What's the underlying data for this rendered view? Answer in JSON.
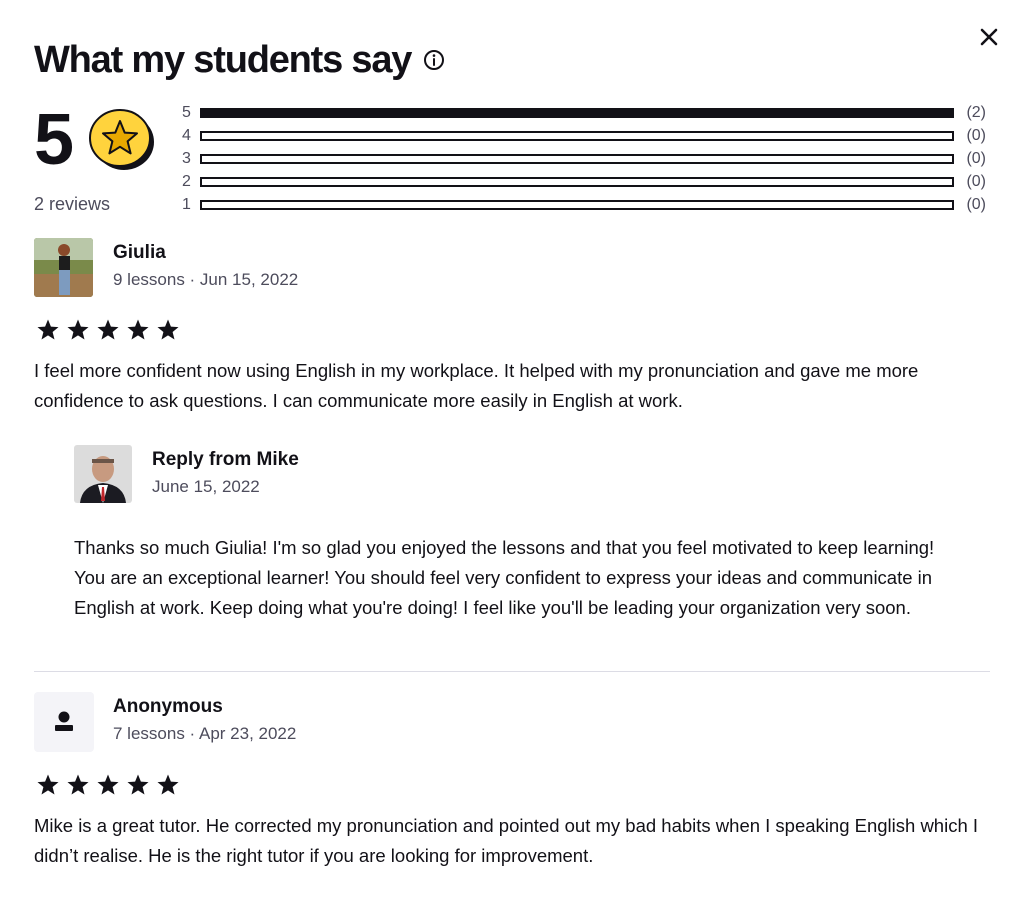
{
  "header": {
    "title": "What my students say",
    "info_icon": "info-circle-icon",
    "close_icon": "close-icon"
  },
  "summary": {
    "rating": "5",
    "reviews_label": "2 reviews",
    "breakdown": [
      {
        "stars": "5",
        "count": "(2)",
        "fraction": 1.0
      },
      {
        "stars": "4",
        "count": "(0)",
        "fraction": 0
      },
      {
        "stars": "3",
        "count": "(0)",
        "fraction": 0
      },
      {
        "stars": "2",
        "count": "(0)",
        "fraction": 0
      },
      {
        "stars": "1",
        "count": "(0)",
        "fraction": 0
      }
    ]
  },
  "reviews": [
    {
      "name": "Giulia",
      "meta": "9 lessons · Jun 15, 2022",
      "rating": 5,
      "text": "I feel more confident now using English in my workplace. It helped with my pronunciation and gave me more confidence to ask questions. I can communicate more easily in English at work.",
      "reply": {
        "title": "Reply from Mike",
        "date": "June 15, 2022",
        "text": "Thanks so much Giulia! I'm so glad you enjoyed the lessons and that you feel motivated to keep learning! You are an exceptional learner! You should feel very confident to express your ideas and communicate in English at work. Keep doing what you're doing! I feel like you'll be leading your organization very soon."
      }
    },
    {
      "name": "Anonymous",
      "meta": "7 lessons · Apr 23, 2022",
      "rating": 5,
      "text": "Mike is a great tutor. He corrected my pronunciation and pointed out my bad habits when I speaking English which I didn’t realise. He is the right tutor if you are looking for improvement."
    }
  ]
}
